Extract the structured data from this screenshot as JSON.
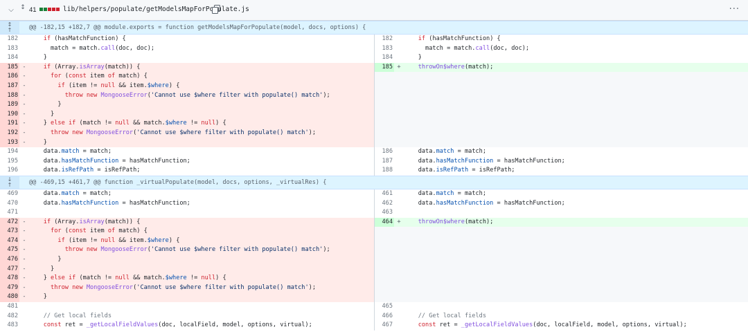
{
  "file": {
    "changes_count": "41",
    "path": "lib/helpers/populate/getModelsMapForPopulate.js",
    "diffstat_colors": [
      "#1a7f37",
      "#1a7f37",
      "#cf222e",
      "#cf222e",
      "#cf222e"
    ]
  },
  "hunks": [
    {
      "header": "@@ -182,15 +182,7 @@ module.exports = function getModelsMapForPopulate(model, docs, options) {",
      "rows": [
        {
          "l": {
            "n": "182",
            "t": "ctx",
            "c": "    if (hasMatchFunction) {"
          },
          "r": {
            "n": "182",
            "t": "ctx",
            "c": "    if (hasMatchFunction) {"
          }
        },
        {
          "l": {
            "n": "183",
            "t": "ctx",
            "c": "      match = match.call(doc, doc);"
          },
          "r": {
            "n": "183",
            "t": "ctx",
            "c": "      match = match.call(doc, doc);"
          }
        },
        {
          "l": {
            "n": "184",
            "t": "ctx",
            "c": "    }"
          },
          "r": {
            "n": "184",
            "t": "ctx",
            "c": "    }"
          }
        },
        {
          "l": {
            "n": "185",
            "t": "del",
            "c": "    if (Array.isArray(match)) {"
          },
          "r": {
            "n": "185",
            "t": "add",
            "c": "    throwOn$where(match);"
          }
        },
        {
          "l": {
            "n": "186",
            "t": "del",
            "c": "      for (const item of match) {"
          },
          "r": {
            "t": "empty"
          }
        },
        {
          "l": {
            "n": "187",
            "t": "del",
            "c": "        if (item != null && item.$where) {"
          },
          "r": {
            "t": "empty"
          }
        },
        {
          "l": {
            "n": "188",
            "t": "del",
            "c": "          throw new MongooseError('Cannot use $where filter with populate() match');"
          },
          "r": {
            "t": "empty"
          }
        },
        {
          "l": {
            "n": "189",
            "t": "del",
            "c": "        }"
          },
          "r": {
            "t": "empty"
          }
        },
        {
          "l": {
            "n": "190",
            "t": "del",
            "c": "      }"
          },
          "r": {
            "t": "empty"
          }
        },
        {
          "l": {
            "n": "191",
            "t": "del",
            "c": "    } else if (match != null && match.$where != null) {"
          },
          "r": {
            "t": "empty"
          }
        },
        {
          "l": {
            "n": "192",
            "t": "del",
            "c": "      throw new MongooseError('Cannot use $where filter with populate() match');"
          },
          "r": {
            "t": "empty"
          }
        },
        {
          "l": {
            "n": "193",
            "t": "del",
            "c": "    }"
          },
          "r": {
            "t": "empty"
          }
        },
        {
          "l": {
            "n": "194",
            "t": "ctx",
            "c": "    data.match = match;"
          },
          "r": {
            "n": "186",
            "t": "ctx",
            "c": "    data.match = match;"
          }
        },
        {
          "l": {
            "n": "195",
            "t": "ctx",
            "c": "    data.hasMatchFunction = hasMatchFunction;"
          },
          "r": {
            "n": "187",
            "t": "ctx",
            "c": "    data.hasMatchFunction = hasMatchFunction;"
          }
        },
        {
          "l": {
            "n": "196",
            "t": "ctx",
            "c": "    data.isRefPath = isRefPath;"
          },
          "r": {
            "n": "188",
            "t": "ctx",
            "c": "    data.isRefPath = isRefPath;"
          }
        }
      ]
    },
    {
      "header": "@@ -469,15 +461,7 @@ function _virtualPopulate(model, docs, options, _virtualRes) {",
      "rows": [
        {
          "l": {
            "n": "469",
            "t": "ctx",
            "c": "    data.match = match;"
          },
          "r": {
            "n": "461",
            "t": "ctx",
            "c": "    data.match = match;"
          }
        },
        {
          "l": {
            "n": "470",
            "t": "ctx",
            "c": "    data.hasMatchFunction = hasMatchFunction;"
          },
          "r": {
            "n": "462",
            "t": "ctx",
            "c": "    data.hasMatchFunction = hasMatchFunction;"
          }
        },
        {
          "l": {
            "n": "471",
            "t": "ctx",
            "c": ""
          },
          "r": {
            "n": "463",
            "t": "ctx",
            "c": ""
          }
        },
        {
          "l": {
            "n": "472",
            "t": "del",
            "c": "    if (Array.isArray(match)) {"
          },
          "r": {
            "n": "464",
            "t": "add",
            "c": "    throwOn$where(match);"
          }
        },
        {
          "l": {
            "n": "473",
            "t": "del",
            "c": "      for (const item of match) {"
          },
          "r": {
            "t": "empty"
          }
        },
        {
          "l": {
            "n": "474",
            "t": "del",
            "c": "        if (item != null && item.$where) {"
          },
          "r": {
            "t": "empty"
          }
        },
        {
          "l": {
            "n": "475",
            "t": "del",
            "c": "          throw new MongooseError('Cannot use $where filter with populate() match');"
          },
          "r": {
            "t": "empty"
          }
        },
        {
          "l": {
            "n": "476",
            "t": "del",
            "c": "        }"
          },
          "r": {
            "t": "empty"
          }
        },
        {
          "l": {
            "n": "477",
            "t": "del",
            "c": "      }"
          },
          "r": {
            "t": "empty"
          }
        },
        {
          "l": {
            "n": "478",
            "t": "del",
            "c": "    } else if (match != null && match.$where != null) {"
          },
          "r": {
            "t": "empty"
          }
        },
        {
          "l": {
            "n": "479",
            "t": "del",
            "c": "      throw new MongooseError('Cannot use $where filter with populate() match');"
          },
          "r": {
            "t": "empty"
          }
        },
        {
          "l": {
            "n": "480",
            "t": "del",
            "c": "    }"
          },
          "r": {
            "t": "empty"
          }
        },
        {
          "l": {
            "n": "481",
            "t": "ctx",
            "c": ""
          },
          "r": {
            "n": "465",
            "t": "ctx",
            "c": ""
          }
        },
        {
          "l": {
            "n": "482",
            "t": "ctx",
            "c": "    // Get local fields"
          },
          "r": {
            "n": "466",
            "t": "ctx",
            "c": "    // Get local fields"
          }
        },
        {
          "l": {
            "n": "483",
            "t": "ctx",
            "c": "    const ret = _getLocalFieldValues(doc, localField, model, options, virtual);"
          },
          "r": {
            "n": "467",
            "t": "ctx",
            "c": "    const ret = _getLocalFieldValues(doc, localField, model, options, virtual);"
          }
        }
      ]
    }
  ]
}
